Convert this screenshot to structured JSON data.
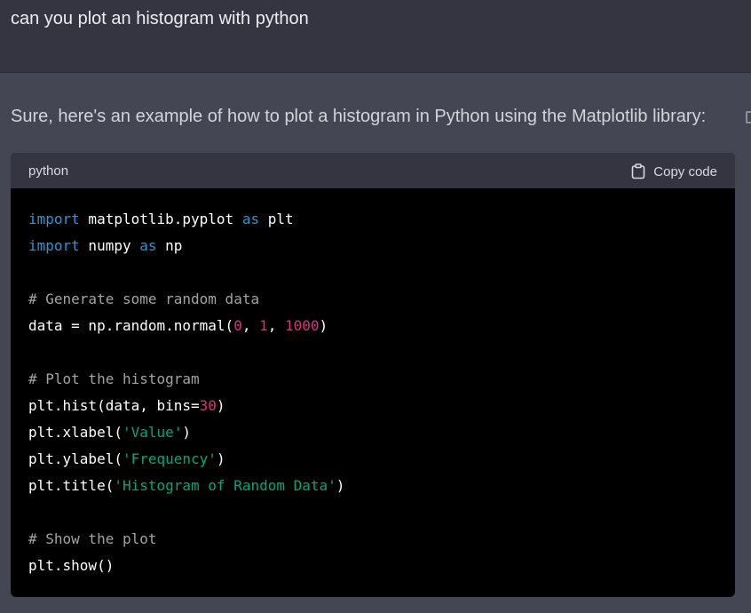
{
  "user_message": "can you plot an histogram with python",
  "assistant_message": "Sure, here's an example of how to plot a histogram in Python using the Matplotlib library:",
  "code_block": {
    "language": "python",
    "copy_label": "Copy code",
    "copy_icon": "clipboard-icon",
    "lines": [
      [
        {
          "t": "import",
          "c": "kw"
        },
        {
          "t": " matplotlib.pyplot ",
          "c": "plain"
        },
        {
          "t": "as",
          "c": "kw"
        },
        {
          "t": " plt",
          "c": "plain"
        }
      ],
      [
        {
          "t": "import",
          "c": "kw"
        },
        {
          "t": " numpy ",
          "c": "plain"
        },
        {
          "t": "as",
          "c": "kw"
        },
        {
          "t": " np",
          "c": "plain"
        }
      ],
      [],
      [
        {
          "t": "# Generate some random data",
          "c": "cm"
        }
      ],
      [
        {
          "t": "data = np.random.normal(",
          "c": "plain"
        },
        {
          "t": "0",
          "c": "num"
        },
        {
          "t": ", ",
          "c": "plain"
        },
        {
          "t": "1",
          "c": "num"
        },
        {
          "t": ", ",
          "c": "plain"
        },
        {
          "t": "1000",
          "c": "num"
        },
        {
          "t": ")",
          "c": "plain"
        }
      ],
      [],
      [
        {
          "t": "# Plot the histogram",
          "c": "cm"
        }
      ],
      [
        {
          "t": "plt.hist(data, bins=",
          "c": "plain"
        },
        {
          "t": "30",
          "c": "num"
        },
        {
          "t": ")",
          "c": "plain"
        }
      ],
      [
        {
          "t": "plt.xlabel(",
          "c": "plain"
        },
        {
          "t": "'Value'",
          "c": "str"
        },
        {
          "t": ")",
          "c": "plain"
        }
      ],
      [
        {
          "t": "plt.ylabel(",
          "c": "plain"
        },
        {
          "t": "'Frequency'",
          "c": "str"
        },
        {
          "t": ")",
          "c": "plain"
        }
      ],
      [
        {
          "t": "plt.title(",
          "c": "plain"
        },
        {
          "t": "'Histogram of Random Data'",
          "c": "str"
        },
        {
          "t": ")",
          "c": "plain"
        }
      ],
      [],
      [
        {
          "t": "# Show the plot",
          "c": "cm"
        }
      ],
      [
        {
          "t": "plt.show()",
          "c": "plain"
        }
      ]
    ]
  },
  "colors": {
    "user_bg": "#343541",
    "assistant_bg": "#444654",
    "code_bg": "#000000",
    "keyword": "#2e95d3",
    "comment": "#a3a3a3",
    "number": "#df3079",
    "string": "#00a67d"
  }
}
